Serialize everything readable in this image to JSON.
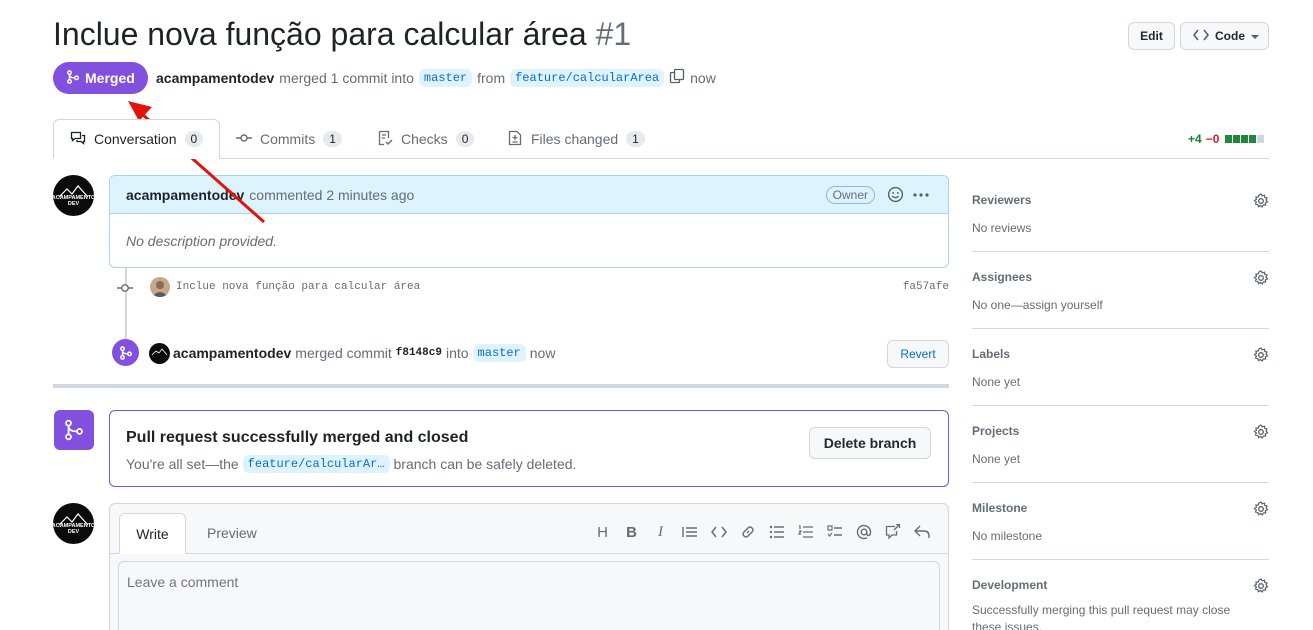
{
  "header": {
    "title": "Inclue nova função para calcular área",
    "number": "#1",
    "edit_label": "Edit",
    "code_label": "Code"
  },
  "status": {
    "badge": "Merged",
    "author": "acampamentodev",
    "text_merged": "merged 1 commit into",
    "base_branch": "master",
    "text_from": "from",
    "head_branch": "feature/calcularArea",
    "time": "now"
  },
  "tabs": [
    {
      "label": "Conversation",
      "count": "0"
    },
    {
      "label": "Commits",
      "count": "1"
    },
    {
      "label": "Checks",
      "count": "0"
    },
    {
      "label": "Files changed",
      "count": "1"
    }
  ],
  "diffstat": {
    "additions": "+4",
    "deletions": "−0"
  },
  "comment": {
    "author": "acampamentodev",
    "action": "commented 2 minutes ago",
    "badge": "Owner",
    "body": "No description provided."
  },
  "commit": {
    "message": "Inclue nova função para calcular área",
    "sha": "fa57afe"
  },
  "merge_event": {
    "author": "acampamentodev",
    "text": "merged commit",
    "sha": "f8148c9",
    "into": "into",
    "branch": "master",
    "time": "now",
    "revert_label": "Revert"
  },
  "merge_status": {
    "title": "Pull request successfully merged and closed",
    "text_before": "You're all set—the",
    "branch": "feature/calcularAr…",
    "text_after": "branch can be safely deleted.",
    "delete_label": "Delete branch"
  },
  "editor": {
    "write_tab": "Write",
    "preview_tab": "Preview",
    "placeholder": "Leave a comment",
    "toolbar": [
      "H",
      "B",
      "I"
    ]
  },
  "avatar_text": "ACAMPAMENTO DEV",
  "sidebar": [
    {
      "title": "Reviewers",
      "value": "No reviews"
    },
    {
      "title": "Assignees",
      "value": "No one—assign yourself"
    },
    {
      "title": "Labels",
      "value": "None yet"
    },
    {
      "title": "Projects",
      "value": "None yet"
    },
    {
      "title": "Milestone",
      "value": "No milestone"
    },
    {
      "title": "Development",
      "value": "Successfully merging this pull request may close these issues."
    }
  ],
  "colors": {
    "merged": "#8250df",
    "link": "#0969da",
    "added": "#1a7f37",
    "deleted": "#cf222e",
    "annotation": "#e3120b"
  }
}
